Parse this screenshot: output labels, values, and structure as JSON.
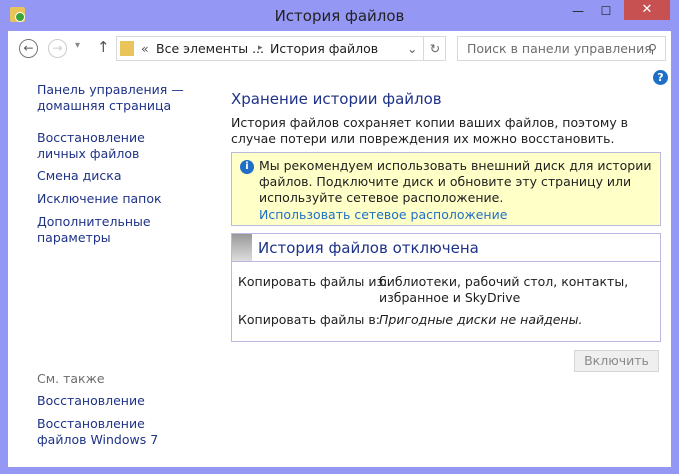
{
  "window": {
    "title": "История файлов",
    "close": "✕",
    "maximize": "☐",
    "minimize": "—"
  },
  "toolbar": {
    "back": "←",
    "forward": "→",
    "recent": "▾",
    "up": "↑",
    "breadcrumb_prefix": "«",
    "breadcrumb": [
      "Все элементы ...",
      "История файлов"
    ],
    "separator": "▸",
    "dropdown": "⌄",
    "refresh": "↻",
    "search_placeholder": "Поиск в панели управления",
    "search_icon": "⚲"
  },
  "sidebar": {
    "items": [
      "Панель управления — домашняя страница",
      "Восстановление личных файлов",
      "Смена диска",
      "Исключение папок",
      "Дополнительные параметры"
    ],
    "see_also": "См. также",
    "see_also_items": [
      "Восстановление",
      "Восстановление файлов Windows 7"
    ]
  },
  "main": {
    "help": "?",
    "heading": "Хранение истории файлов",
    "description": "История файлов сохраняет копии ваших файлов, поэтому в случае потери или повреждения их можно восстановить.",
    "info": {
      "icon": "i",
      "text": "Мы рекомендуем использовать внешний диск для истории файлов. Подключите диск и обновите эту страницу или используйте сетевое расположение.",
      "link": "Использовать сетевое расположение"
    },
    "status_title": "История файлов отключена",
    "rows": [
      {
        "label": "Копировать файлы из:",
        "value": "библиотеки, рабочий стол, контакты, избранное и SkyDrive"
      },
      {
        "label": "Копировать файлы в:",
        "value": "Пригодные диски не найдены."
      }
    ],
    "enable_button": "Включить"
  }
}
